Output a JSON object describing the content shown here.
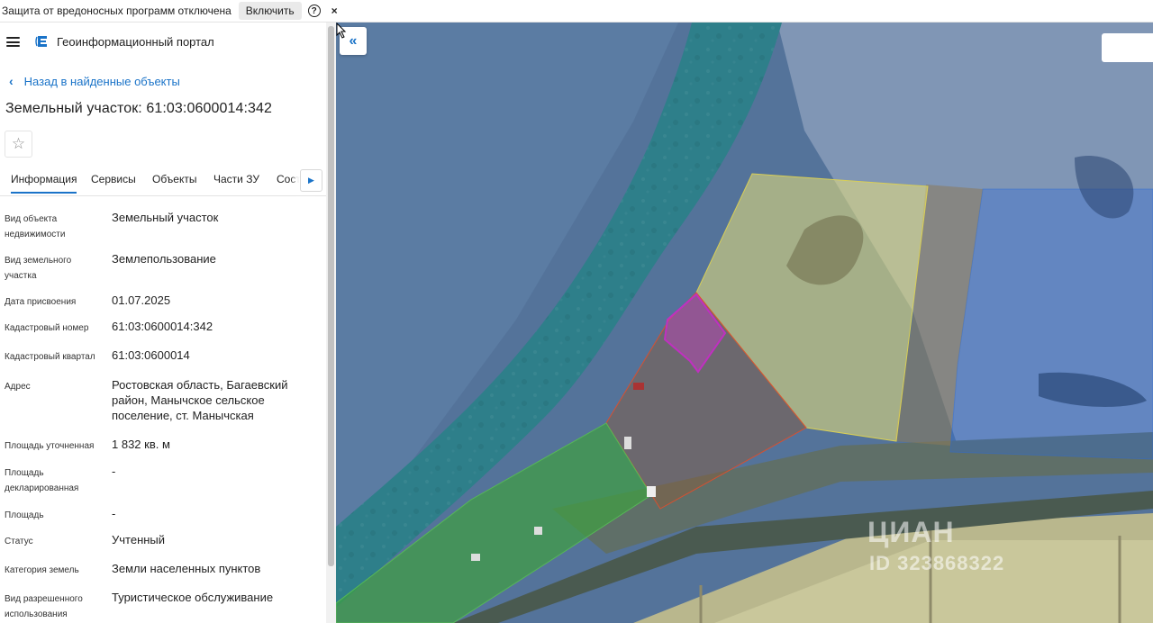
{
  "notification": {
    "text": "Защита от вредоносных программ отключена",
    "enable_label": "Включить",
    "help_glyph": "?",
    "close_glyph": "×"
  },
  "appbar": {
    "title": "Геоинформационный портал"
  },
  "back_link": "Назад в найденные объекты",
  "page_title": "Земельный участок: 61:03:0600014:342",
  "tabs": [
    {
      "label": "Информация",
      "active": true
    },
    {
      "label": "Сервисы",
      "active": false
    },
    {
      "label": "Объекты",
      "active": false
    },
    {
      "label": "Части ЗУ",
      "active": false
    },
    {
      "label": "Состав",
      "active": false
    }
  ],
  "properties": [
    {
      "key": "Вид объекта недвижимости",
      "value": "Земельный участок"
    },
    {
      "key": "Вид земельного участка",
      "value": "Землепользование"
    },
    {
      "key": "Дата присвоения",
      "value": "01.07.2025"
    },
    {
      "key": "Кадастровый номер",
      "value": "61:03:0600014:342"
    },
    {
      "key": "Кадастровый квартал",
      "value": "61:03:0600014"
    },
    {
      "key": "Адрес",
      "value": "Ростовская область, Багаевский район, Манычское сельское поселение, ст. Манычская"
    },
    {
      "key": "Площадь уточненная",
      "value": "1 832 кв. м"
    },
    {
      "key": "Площадь декларированная",
      "value": "-"
    },
    {
      "key": "Площадь",
      "value": "-"
    },
    {
      "key": "Статус",
      "value": "Учтенный"
    },
    {
      "key": "Категория земель",
      "value": "Земли населенных пунктов"
    },
    {
      "key": "Вид разрешенного использования",
      "value": "Туристическое обслуживание"
    }
  ],
  "map": {
    "collapse_glyph": "«",
    "watermark": "ЦИАН",
    "watermark_id": "ID 323868322"
  },
  "colors": {
    "accent": "#1a73c8",
    "river": "#2e7f8a",
    "parcel_selected": "#c040c0",
    "zone_yellow": "#e8e07a",
    "zone_green": "#3fa040",
    "zone_blue": "#2d6bd6"
  }
}
